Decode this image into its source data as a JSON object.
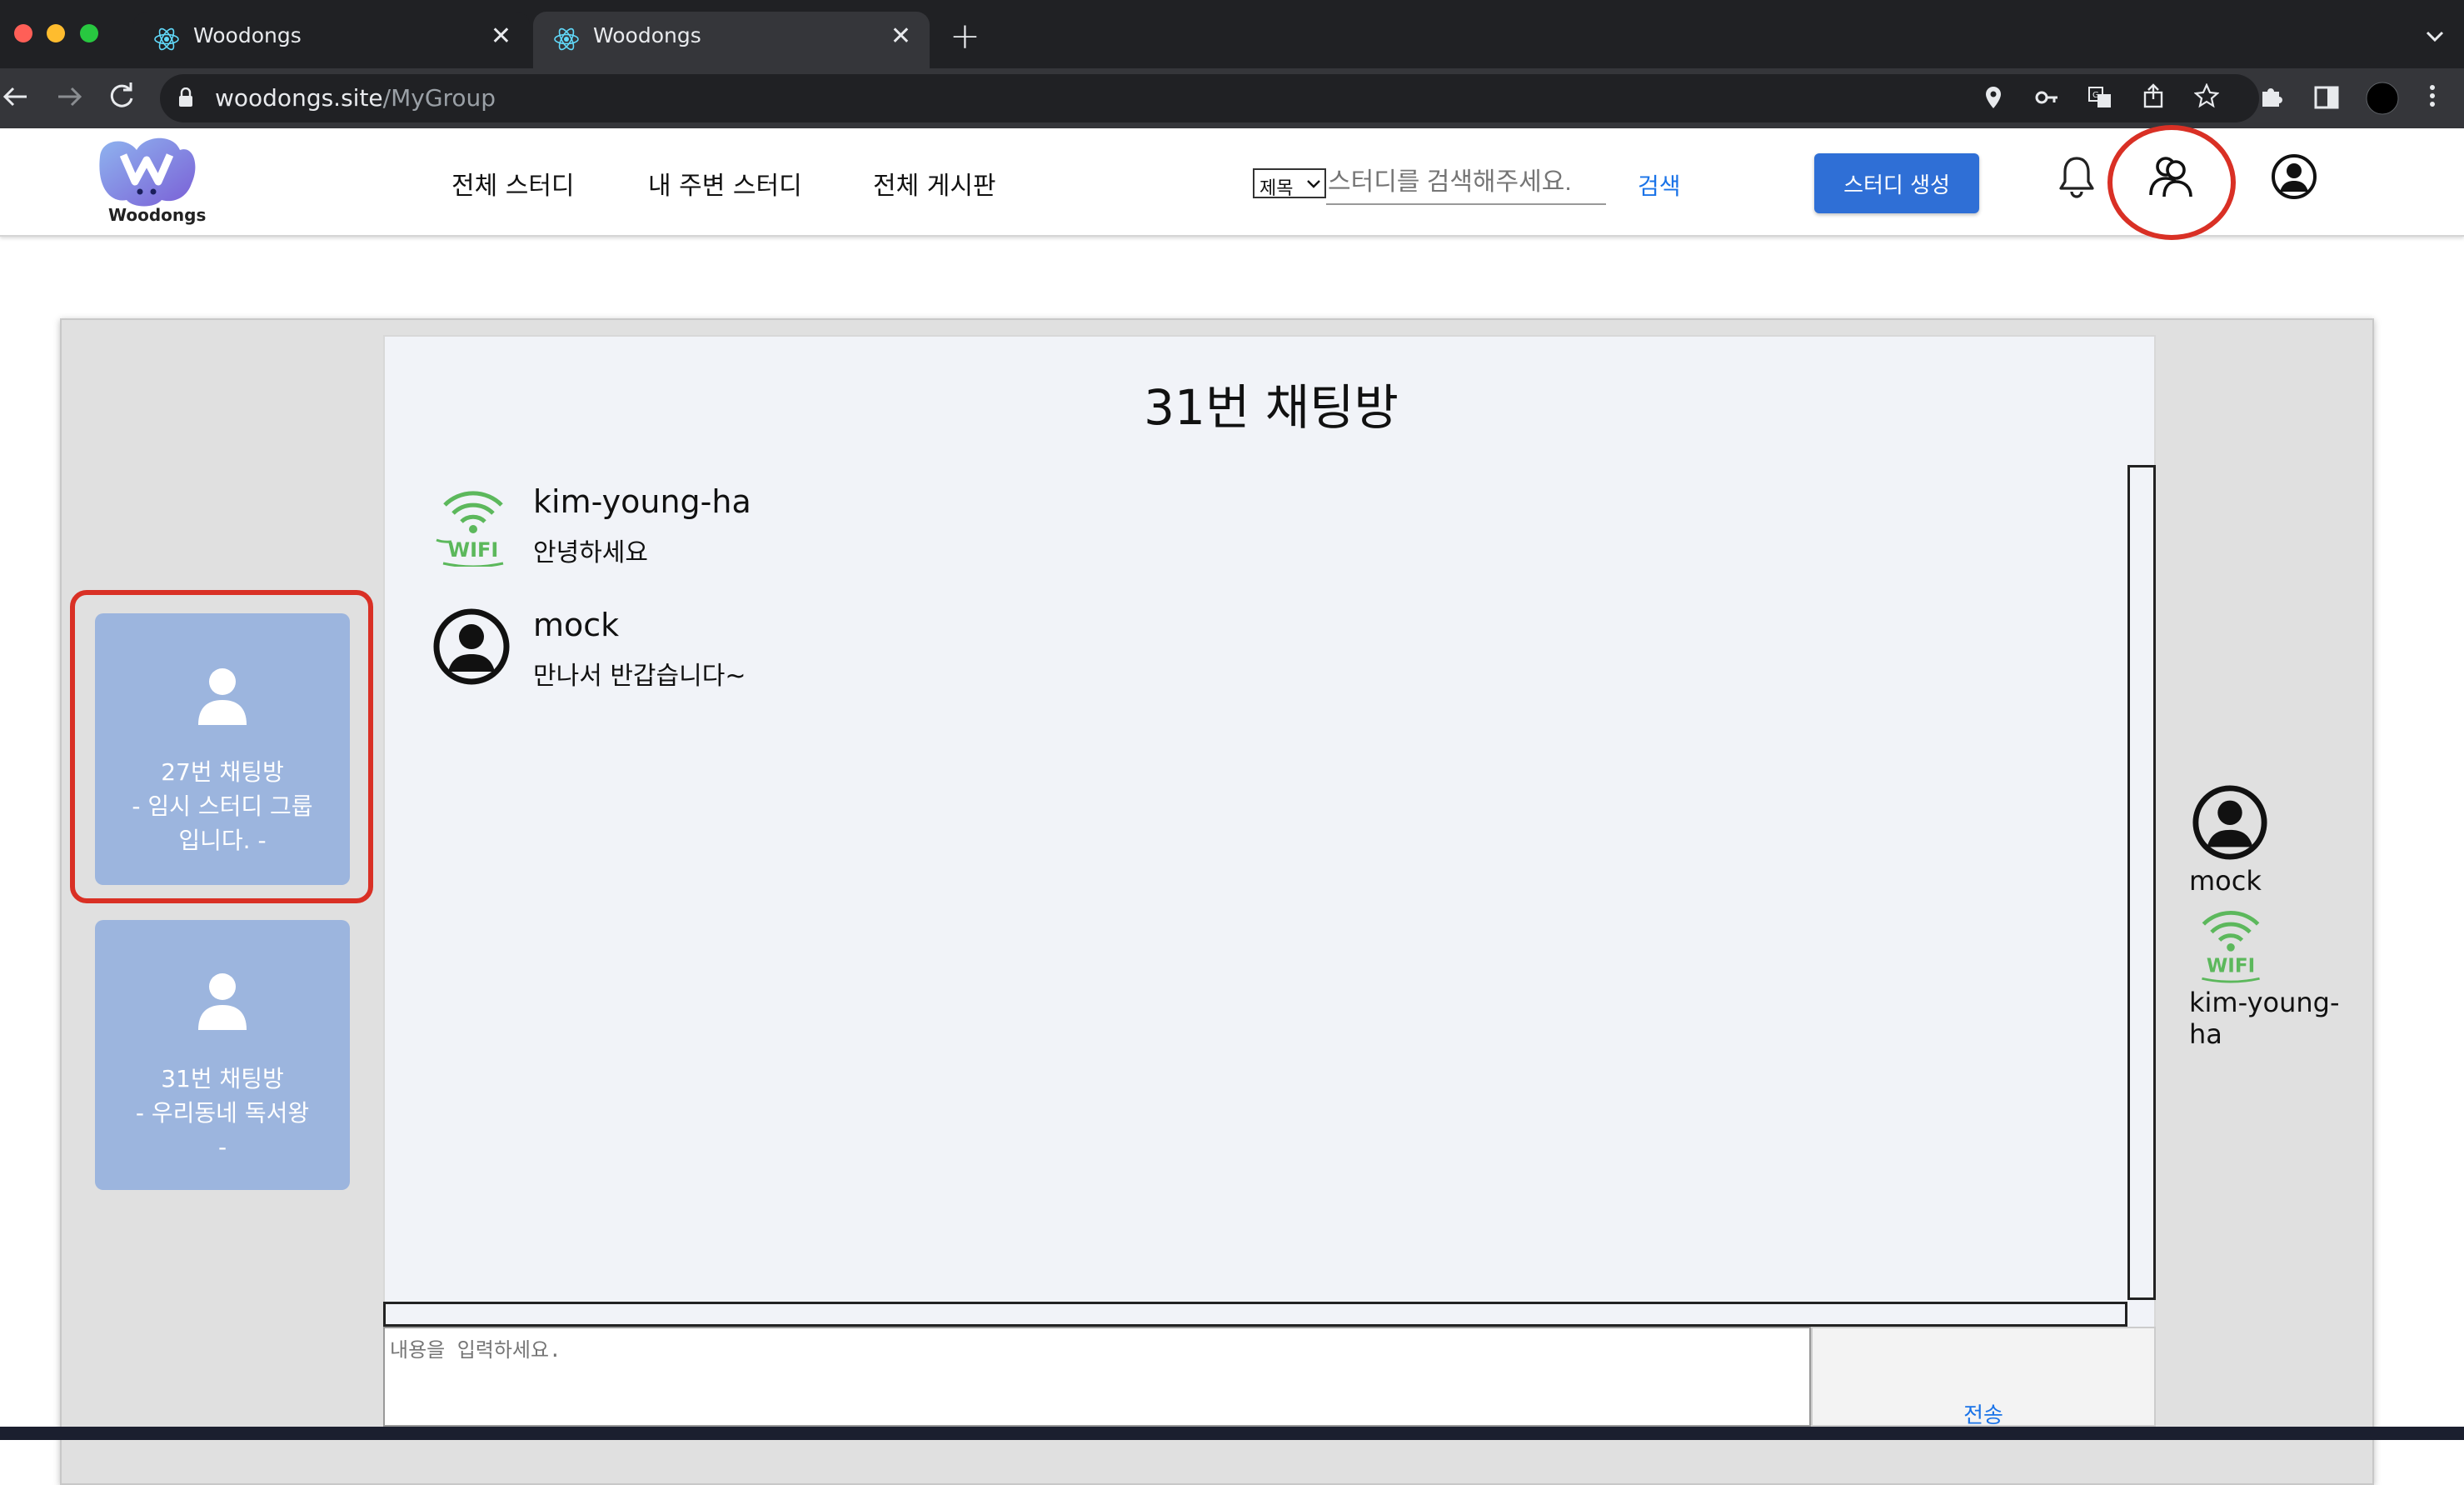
{
  "browser": {
    "tabs": [
      {
        "title": "Woodongs",
        "active": false
      },
      {
        "title": "Woodongs",
        "active": true
      }
    ],
    "new_tab_symbol": "+",
    "tab_close_symbol": "✕",
    "url_host": "woodongs.site",
    "url_path": "/MyGroup",
    "icons": [
      "back-icon",
      "forward-icon",
      "reload-icon",
      "lock-icon",
      "location-icon",
      "key-icon",
      "translate-icon",
      "share-icon",
      "bookmark-star-icon",
      "extensions-icon",
      "sidepanel-icon",
      "profile-icon",
      "menu-icon"
    ]
  },
  "header": {
    "logo_text": "Woodongs",
    "nav": [
      "전체 스터디",
      "내 주변 스터디",
      "전체 게시판"
    ],
    "search_select": "제목",
    "search_placeholder": "스터디를 검색해주세요.",
    "search_button": "검색",
    "create_button": "스터디 생성",
    "icons": [
      "bell-icon",
      "group-icon",
      "user-circle-icon"
    ]
  },
  "rooms": [
    {
      "line1": "27번 채팅방",
      "line2": "- 임시 스터디 그룹",
      "line3": "입니다. -",
      "highlighted": true
    },
    {
      "line1": "31번 채팅방",
      "line2": "- 우리동네 독서왕",
      "line3": "-",
      "highlighted": false
    }
  ],
  "chat": {
    "title": "31번 채팅방",
    "messages": [
      {
        "user": "kim-young-ha",
        "text": "안녕하세요",
        "avatar": "wifi-avatar"
      },
      {
        "user": "mock",
        "text": "만나서 반갑습니다~",
        "avatar": "user-circle-avatar"
      }
    ],
    "input_placeholder": "내용을 입력하세요.",
    "send_label": "전송"
  },
  "members": [
    {
      "name": "mock",
      "avatar": "user-circle-avatar"
    },
    {
      "name": "kim-young-ha",
      "avatar": "wifi-avatar"
    }
  ],
  "colors": {
    "highlight_red": "#d93025",
    "room_card": "#9cb5de",
    "primary_blue": "#2f6fd6",
    "wifi_green": "#5cb85c"
  }
}
